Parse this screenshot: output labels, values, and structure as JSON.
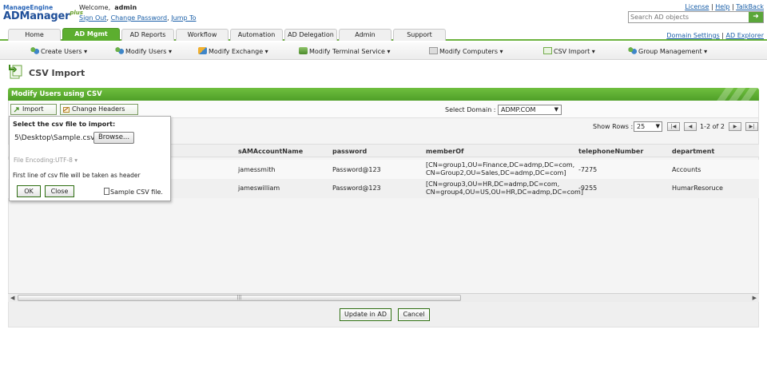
{
  "header": {
    "logo_top": "ManageEngine",
    "logo_main": "ADManager",
    "logo_plus": "plus",
    "welcome_text": "Welcome,",
    "username": "admin",
    "sign_out": "Sign Out",
    "change_password": "Change Password",
    "jump_to": "Jump To",
    "sep": ",",
    "top_links": [
      "License",
      "Help",
      "TalkBack"
    ],
    "search_placeholder": "Search AD objects",
    "domain_links": [
      "Domain Settings",
      "AD Explorer"
    ]
  },
  "tabs": [
    "Home",
    "AD Mgmt",
    "AD Reports",
    "Workflow",
    "Automation",
    "AD Delegation",
    "Admin",
    "Support"
  ],
  "active_tab": "AD Mgmt",
  "submenu": [
    "Create Users",
    "Modify Users",
    "Modify Exchange",
    "Modify Terminal Service",
    "Modify Computers",
    "CSV Import",
    "Group Management"
  ],
  "page": {
    "title": "CSV Import"
  },
  "panel": {
    "title": "Modify Users using CSV",
    "import_label": "Import",
    "change_headers_label": "Change Headers",
    "select_domain_label": "Select Domain :",
    "domain_value": "ADMP.COM",
    "show_rows_label": "Show Rows :",
    "rows_value": "25",
    "page_info": "1-2 of 2"
  },
  "grid": {
    "columns": [
      "sAMAccountName",
      "password",
      "memberOf",
      "telephoneNumber",
      "department"
    ],
    "rows": [
      {
        "sAMAccountName": "jamessmith",
        "password": "Password@123",
        "memberOf_line1": "[CN=group1,OU=Finance,DC=admp,DC=com,",
        "memberOf_line2": "CN=Group2,OU=Sales,DC=admp,DC=com]",
        "telephoneNumber": "-7275",
        "department": "Accounts"
      },
      {
        "sAMAccountName": "jameswilliam",
        "password": "Password@123",
        "memberOf_line1": "[CN=group3,OU=HR,DC=admp,DC=com,",
        "memberOf_line2": "CN=group4,OU=US,OU=HR,DC=admp,DC=com]",
        "telephoneNumber": "-9255",
        "department": "HumarResoruce"
      }
    ]
  },
  "footer": {
    "update_label": "Update in AD",
    "cancel_label": "Cancel"
  },
  "popup": {
    "title": "Select the csv file to import:",
    "file_path": "5\\Desktop\\Sample.csv",
    "browse_label": "Browse...",
    "encoding_label": "File Encoding:UTF-8",
    "header_note": "First line of csv file will be taken as header",
    "ok_label": "OK",
    "close_label": "Close",
    "sample_label": "Sample CSV file."
  },
  "colors": {
    "accent_green": "#5cae2f",
    "link_blue": "#1a5fa8"
  }
}
